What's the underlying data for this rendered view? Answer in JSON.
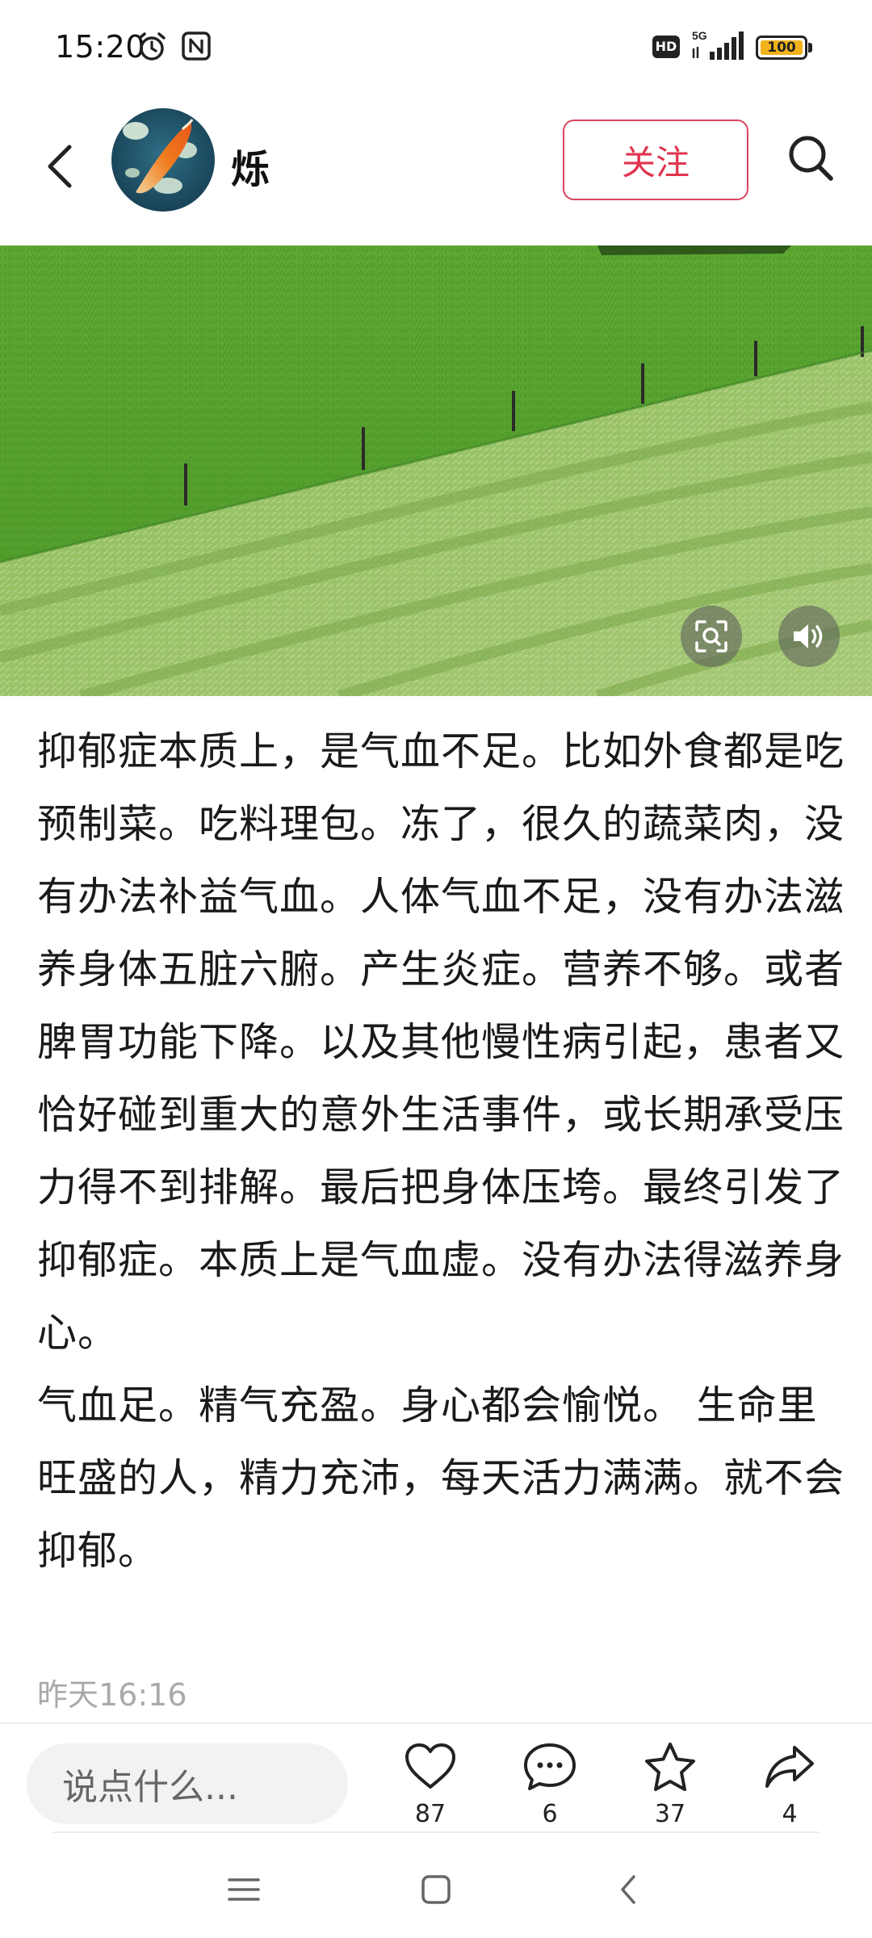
{
  "status_bar": {
    "time": "15:20",
    "hd_label": "HD",
    "network_label": "5G",
    "battery": "100",
    "battery_color": "#f2b21a"
  },
  "header": {
    "username": "烁",
    "follow_label": "关注",
    "accent_color": "#e0344f",
    "icons": [
      "back-arrow-icon",
      "avatar",
      "search-icon"
    ]
  },
  "media": {
    "icons": [
      "screenshot-scan-icon",
      "speaker-icon"
    ]
  },
  "post": {
    "paragraphs": [
      "抑郁症本质上，是气血不足。比如外食都是吃预制菜。吃料理包。冻了，很久的蔬菜肉，没有办法补益气血。人体气血不足，没有办法滋养身体五脏六腑。产生炎症。营养不够。或者脾胃功能下降。以及其他慢性病引起，患者又恰好碰到重大的意外生活事件，或长期承受压力得不到排解。最后把身体压垮。最终引发了抑郁症。本质上是气血虚。没有办法得滋养身心。",
      "气血足。精气充盈。身心都会愉悦。 生命里旺盛的人，精力充沛，每天活力满满。就不会抑郁。"
    ],
    "timestamp": "昨天16:16"
  },
  "action_bar": {
    "comment_placeholder": "说点什么...",
    "likes": "87",
    "comments": "6",
    "stars": "37",
    "shares": "4"
  },
  "nav_bar": {
    "icons": [
      "menu-icon",
      "home-square-icon",
      "back-chevron-icon"
    ]
  }
}
